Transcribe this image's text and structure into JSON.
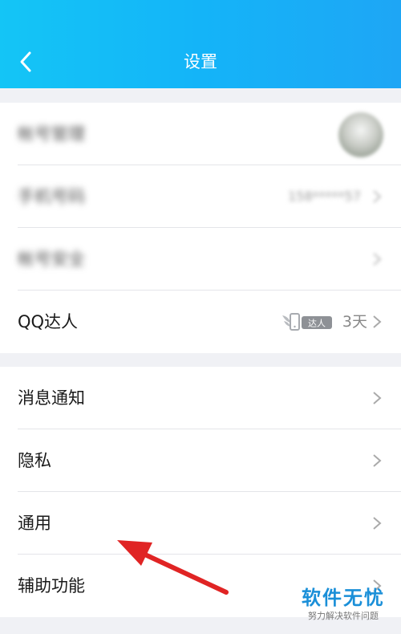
{
  "header": {
    "title": "设置",
    "back_icon": "chevron-left-icon"
  },
  "account_group": [
    {
      "label": "帐号管理",
      "obscured": true
    },
    {
      "label": "手机号码",
      "obscured": true,
      "value": "158*****57"
    },
    {
      "label": "帐号安全",
      "obscured": true
    },
    {
      "label": "QQ达人",
      "badge_text": "达人",
      "days": "3天"
    }
  ],
  "settings_group": [
    {
      "label": "消息通知"
    },
    {
      "label": "隐私"
    },
    {
      "label": "通用"
    },
    {
      "label": "辅助功能"
    }
  ],
  "watermark": {
    "title": "软件无忧",
    "subtitle": "努力解决软件问题"
  },
  "colors": {
    "header": "#14b4f8",
    "arrow": "#e02424",
    "watermark": "#1a8fd8"
  }
}
